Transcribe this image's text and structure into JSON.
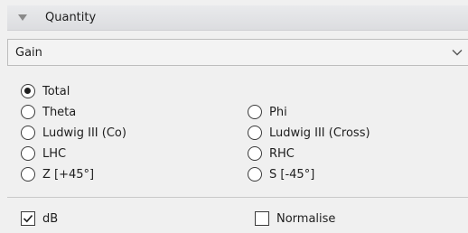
{
  "section": {
    "title": "Quantity",
    "collapse_icon": "chevron-down-icon"
  },
  "quantity_select": {
    "value": "Gain",
    "icon": "chevron-down-icon"
  },
  "radios": {
    "total": {
      "label": "Total",
      "checked": true
    },
    "theta": {
      "label": "Theta",
      "checked": false
    },
    "phi": {
      "label": "Phi",
      "checked": false
    },
    "ludwig_co": {
      "label": "Ludwig III (Co)",
      "checked": false
    },
    "ludwig_cross": {
      "label": "Ludwig III (Cross)",
      "checked": false
    },
    "lhc": {
      "label": "LHC",
      "checked": false
    },
    "rhc": {
      "label": "RHC",
      "checked": false
    },
    "z45": {
      "label": "Z [+45°]",
      "checked": false
    },
    "s45": {
      "label": "S [-45°]",
      "checked": false
    }
  },
  "checkboxes": {
    "db": {
      "label": "dB",
      "checked": true
    },
    "normalise": {
      "label": "Normalise",
      "checked": false
    }
  }
}
